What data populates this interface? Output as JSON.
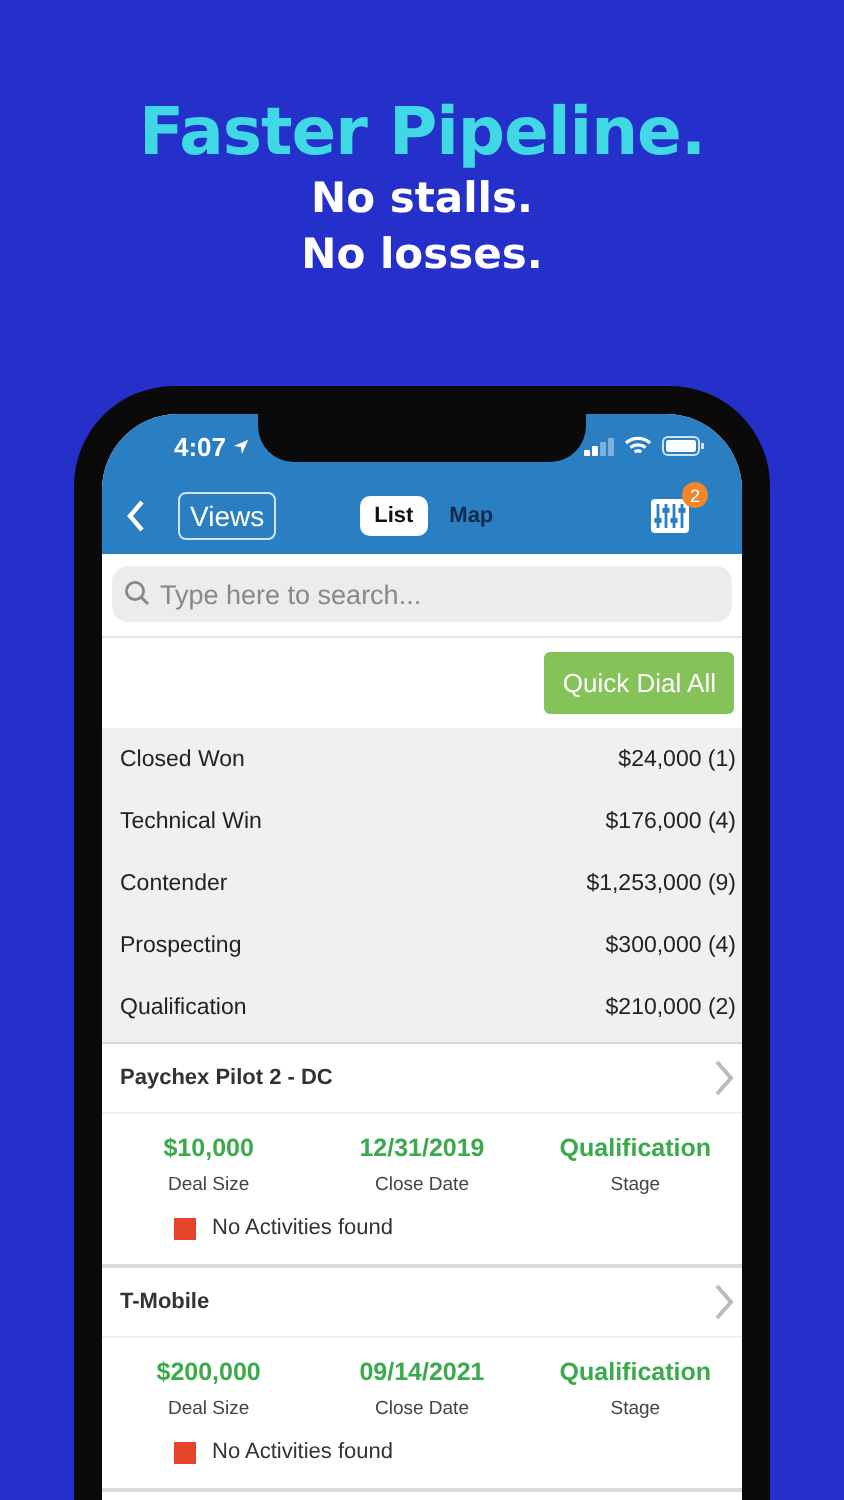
{
  "headline": "Faster Pipeline.",
  "taglines": [
    "No stalls.",
    "No losses."
  ],
  "status_bar": {
    "time": "4:07"
  },
  "nav": {
    "views_button": "Views",
    "tabs": [
      {
        "label": "List",
        "selected": true
      },
      {
        "label": "Map",
        "selected": false
      }
    ],
    "filter_badge": "2"
  },
  "search": {
    "placeholder": "Type here to search..."
  },
  "quick_dial_button": "Quick Dial All",
  "summary": [
    {
      "stage": "Closed Won",
      "total": "$24,000 (1)"
    },
    {
      "stage": "Technical Win",
      "total": "$176,000 (4)"
    },
    {
      "stage": "Contender",
      "total": "$1,253,000 (9)"
    },
    {
      "stage": "Prospecting",
      "total": "$300,000 (4)"
    },
    {
      "stage": "Qualification",
      "total": "$210,000 (2)"
    }
  ],
  "deals": [
    {
      "name": "Paychex Pilot 2 - DC",
      "fields": [
        {
          "value": "$10,000",
          "label": "Deal Size"
        },
        {
          "value": "12/31/2019",
          "label": "Close Date"
        },
        {
          "value": "Qualification",
          "label": "Stage"
        }
      ],
      "activity": "No Activities found"
    },
    {
      "name": "T-Mobile",
      "fields": [
        {
          "value": "$200,000",
          "label": "Deal Size"
        },
        {
          "value": "09/14/2021",
          "label": "Close Date"
        },
        {
          "value": "Qualification",
          "label": "Stage"
        }
      ],
      "activity": "No Activities found"
    }
  ]
}
